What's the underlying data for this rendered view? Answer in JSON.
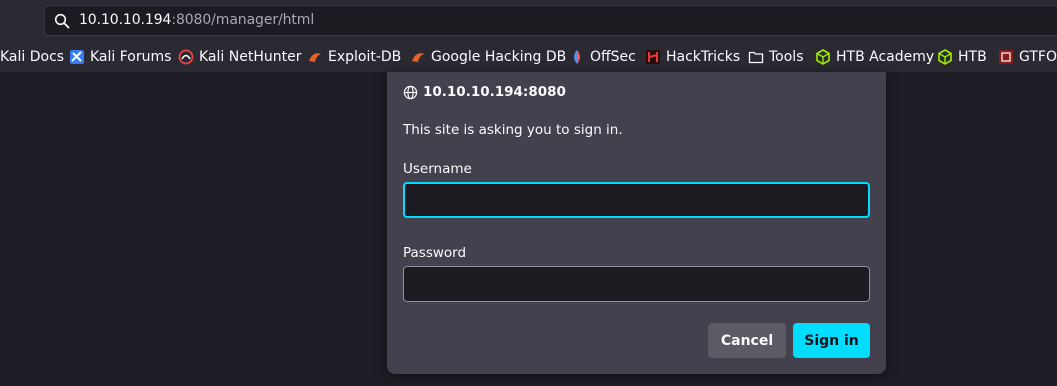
{
  "browser": {
    "url_host": "10.10.10.194",
    "url_path": ":8080/manager/html"
  },
  "bookmarks": [
    {
      "label": "Kali Docs",
      "icon": "kali-docs-icon"
    },
    {
      "label": "Kali Forums",
      "icon": "kali-forums-icon"
    },
    {
      "label": "Kali NetHunter",
      "icon": "kali-nethunter-icon"
    },
    {
      "label": "Exploit-DB",
      "icon": "exploit-db-icon"
    },
    {
      "label": "Google Hacking DB",
      "icon": "google-hacking-db-icon"
    },
    {
      "label": "OffSec",
      "icon": "offsec-icon"
    },
    {
      "label": "HackTricks",
      "icon": "hacktricks-icon"
    },
    {
      "label": "Tools",
      "icon": "folder-icon"
    },
    {
      "label": "HTB Academy",
      "icon": "htb-academy-icon"
    },
    {
      "label": "HTB",
      "icon": "htb-icon"
    },
    {
      "label": "GTFO",
      "icon": "gtfobins-icon"
    }
  ],
  "dialog": {
    "origin": "10.10.10.194:8080",
    "message": "This site is asking you to sign in.",
    "username_label": "Username",
    "username_value": "",
    "password_label": "Password",
    "password_value": "",
    "cancel_label": "Cancel",
    "signin_label": "Sign in"
  },
  "colors": {
    "accent": "#00ddff",
    "toolbar": "#2b2a33",
    "dialog": "#42414d",
    "page": "#1f1e26"
  }
}
